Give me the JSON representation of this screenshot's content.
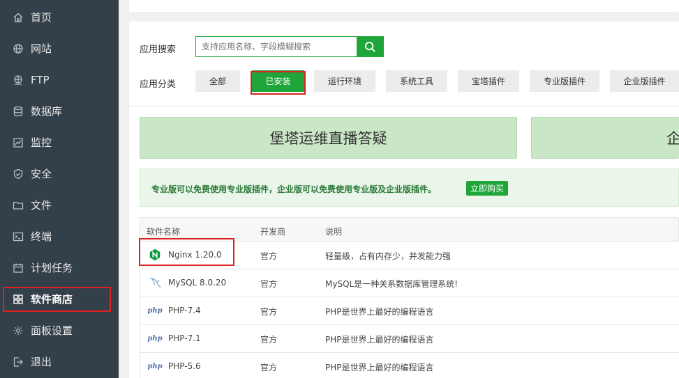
{
  "sidebar": {
    "items": [
      {
        "label": "首页",
        "icon": "home-icon"
      },
      {
        "label": "网站",
        "icon": "globe-icon"
      },
      {
        "label": "FTP",
        "icon": "ftp-icon"
      },
      {
        "label": "数据库",
        "icon": "database-icon"
      },
      {
        "label": "监控",
        "icon": "monitor-icon"
      },
      {
        "label": "安全",
        "icon": "shield-icon"
      },
      {
        "label": "文件",
        "icon": "folder-icon"
      },
      {
        "label": "终端",
        "icon": "terminal-icon"
      },
      {
        "label": "计划任务",
        "icon": "calendar-icon"
      },
      {
        "label": "软件商店",
        "icon": "grid-icon"
      },
      {
        "label": "面板设置",
        "icon": "gear-icon"
      },
      {
        "label": "退出",
        "icon": "logout-icon"
      }
    ],
    "active_index": 9
  },
  "search": {
    "label": "应用搜索",
    "placeholder": "支持应用名称、字段模糊搜索"
  },
  "categories": {
    "label": "应用分类",
    "items": [
      "全部",
      "已安装",
      "运行环境",
      "系统工具",
      "宝塔插件",
      "专业版插件",
      "企业版插件"
    ],
    "active": "已安装"
  },
  "banners": [
    "堡塔运维直播答疑",
    "企"
  ],
  "notice": {
    "text": "专业版可以免费使用专业版插件，企业版可以免费使用专业版及企业版插件。",
    "button": "立即购买"
  },
  "table": {
    "headers": [
      "软件名称",
      "开发商",
      "说明"
    ],
    "rows": [
      {
        "name": "Nginx 1.20.0",
        "logo": "nginx-icon",
        "vendor": "官方",
        "desc": "轻量级，占有内存少，并发能力强"
      },
      {
        "name": "MySQL 8.0.20",
        "logo": "mysql-icon",
        "vendor": "官方",
        "desc": "MySQL是一种关系数据库管理系统!"
      },
      {
        "name": "PHP-7.4",
        "logo": "php-icon",
        "vendor": "官方",
        "desc": "PHP是世界上最好的编程语言"
      },
      {
        "name": "PHP-7.1",
        "logo": "php-icon",
        "vendor": "官方",
        "desc": "PHP是世界上最好的编程语言"
      },
      {
        "name": "PHP-5.6",
        "logo": "php-icon",
        "vendor": "官方",
        "desc": "PHP是世界上最好的编程语言"
      }
    ],
    "php_logo_text": "php"
  },
  "colors": {
    "sidebar_bg": "#344049",
    "accent": "#20a53a",
    "highlight": "#e02020"
  }
}
